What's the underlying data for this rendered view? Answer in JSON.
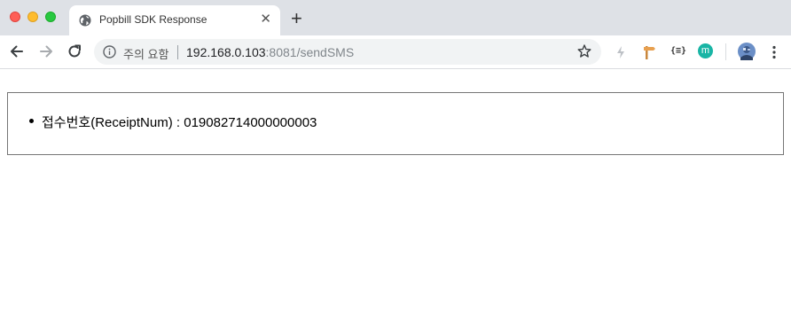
{
  "window": {
    "tab_title": "Popbill SDK Response",
    "tab_close": "✕",
    "new_tab": "+"
  },
  "toolbar": {
    "security_label": "주의 요함",
    "url_host": "192.168.0.103",
    "url_rest": ":8081/sendSMS"
  },
  "extensions": {
    "bracket_label": "{≡}",
    "m_label": "m"
  },
  "content": {
    "items": [
      {
        "label": "접수번호(ReceiptNum) : ",
        "value": "019082714000000003"
      }
    ]
  },
  "colors": {
    "titlebar": "#dee1e6",
    "omnibox": "#f1f3f4",
    "teal_ext": "#19b5a5"
  }
}
